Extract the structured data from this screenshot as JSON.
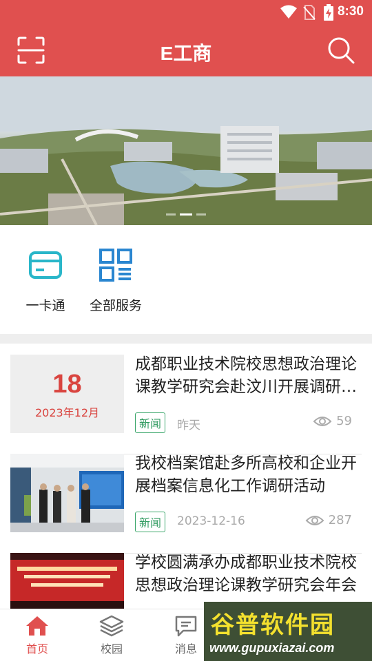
{
  "status_bar": {
    "time": "8:30",
    "icons": [
      "wifi-icon",
      "no-sim-icon",
      "battery-charging-icon"
    ]
  },
  "header": {
    "title": "E工商",
    "left_icon": "scan-icon",
    "right_icon": "search-icon",
    "accent_color": "#e0504f"
  },
  "banner": {
    "slide_count": 3,
    "active_slide": 2
  },
  "services": [
    {
      "label": "一卡通",
      "icon": "card-icon",
      "color": "#29b6c9"
    },
    {
      "label": "全部服务",
      "icon": "grid-list-icon",
      "color": "#2a86d0"
    }
  ],
  "news": [
    {
      "date_day": "18",
      "date_month": "2023年12月",
      "title": "成都职业技术院校思想政治理论课教学研究会赴汶川开展调研活动",
      "tag": "新闻",
      "time": "昨天",
      "views": "59"
    },
    {
      "title": "我校档案馆赴多所高校和企业开展档案信息化工作调研活动",
      "tag": "新闻",
      "time": "2023-12-16",
      "views": "287"
    },
    {
      "title": "学校圆满承办成都职业技术院校思想政治理论课教学研究会年会"
    }
  ],
  "tabbar": [
    {
      "label": "首页",
      "icon": "home-icon",
      "active": true
    },
    {
      "label": "校园",
      "icon": "layers-icon",
      "active": false
    },
    {
      "label": "消息",
      "icon": "message-icon",
      "active": false
    }
  ],
  "watermark": {
    "title": "谷普软件园",
    "url": "www.gupuxiazai.com"
  }
}
